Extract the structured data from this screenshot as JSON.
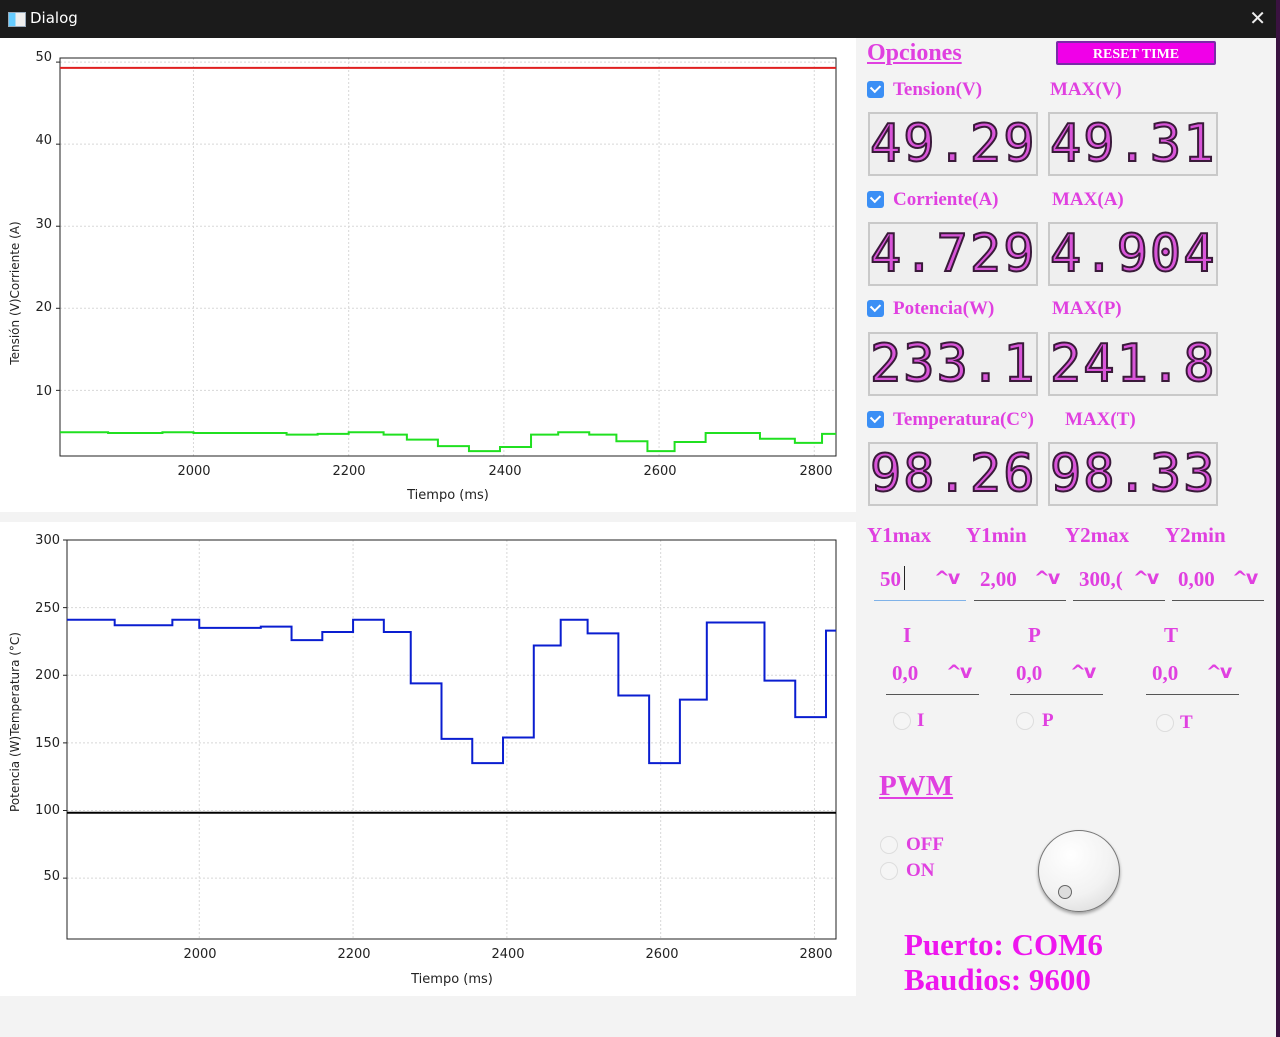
{
  "window": {
    "title": "Dialog"
  },
  "chart1": {
    "ylabel": "Tensión (V)Corriente (A)",
    "xlabel": "Tiempo (ms)",
    "yticks": [
      "50",
      "40",
      "30",
      "20",
      "10"
    ],
    "xticks": [
      "2000",
      "2200",
      "2400",
      "2600",
      "2800"
    ]
  },
  "chart2": {
    "ylabel": "Potencia (W)Temperatura (°C)",
    "xlabel": "Tiempo (ms)",
    "yticks": [
      "300",
      "250",
      "200",
      "150",
      "100",
      "50"
    ],
    "xticks": [
      "2000",
      "2200",
      "2400",
      "2600",
      "2800"
    ]
  },
  "chart_data": [
    {
      "type": "line",
      "xlabel": "Tiempo (ms)",
      "ylabel": "Tensión (V)Corriente (A)",
      "xlim": [
        1828,
        2828
      ],
      "ylim": [
        2,
        50.5
      ],
      "series": [
        {
          "color": "#e02020",
          "step": true,
          "x": [
            1828,
            2828
          ],
          "y": [
            49.3,
            49.3
          ]
        },
        {
          "color": "#20e020",
          "step": true,
          "x": [
            1828,
            1890,
            1960,
            2000,
            2080,
            2120,
            2160,
            2200,
            2245,
            2275,
            2315,
            2355,
            2395,
            2435,
            2470,
            2510,
            2545,
            2585,
            2620,
            2660,
            2730,
            2775,
            2810,
            2828
          ],
          "y": [
            4.9,
            4.8,
            4.9,
            4.8,
            4.8,
            4.6,
            4.7,
            4.9,
            4.6,
            4.0,
            3.2,
            2.6,
            3.1,
            4.6,
            4.9,
            4.6,
            3.8,
            2.6,
            3.7,
            4.8,
            4.1,
            3.6,
            4.7,
            4.7
          ]
        }
      ]
    },
    {
      "type": "line",
      "xlabel": "Tiempo (ms)",
      "ylabel": "Potencia (W)Temperatura (°C)",
      "xlim": [
        1828,
        2828
      ],
      "ylim": [
        5,
        300
      ],
      "series": [
        {
          "color": "#000000",
          "step": true,
          "x": [
            1828,
            2828
          ],
          "y": [
            98.3,
            98.3
          ]
        },
        {
          "color": "#0a1ed0",
          "step": true,
          "x": [
            1828,
            1890,
            1965,
            2000,
            2080,
            2120,
            2160,
            2200,
            2240,
            2275,
            2315,
            2355,
            2395,
            2435,
            2470,
            2505,
            2545,
            2585,
            2625,
            2660,
            2735,
            2775,
            2815,
            2828
          ],
          "y": [
            241,
            237,
            241,
            235,
            236,
            226,
            232,
            241,
            232,
            194,
            153,
            135,
            154,
            222,
            241,
            231,
            185,
            135,
            182,
            239,
            196,
            169,
            233,
            233
          ]
        }
      ]
    }
  ],
  "options": {
    "header": "Opciones",
    "reset_label": "RESET TIME",
    "tension_label": "Tension(V)",
    "max_v_label": "MAX(V)",
    "tension_value": "49.29",
    "max_v_value": "49.31",
    "corriente_label": "Corriente(A)",
    "max_a_label": "MAX(A)",
    "corriente_value": "4.729",
    "max_a_value": "4.904",
    "potencia_label": "Potencia(W)",
    "max_p_label": "MAX(P)",
    "potencia_value": "233.1",
    "max_p_value": "241.8",
    "temperatura_label": "Temperatura(C°)",
    "max_t_label": "MAX(T)",
    "temperatura_value": "98.26",
    "max_t_value": "98.33",
    "checkbox_tension": true,
    "checkbox_corriente": true,
    "checkbox_potencia": true,
    "checkbox_temperatura": true
  },
  "limits": {
    "y1max_label": "Y1max",
    "y1min_label": "Y1min",
    "y2max_label": "Y2max",
    "y2min_label": "Y2min",
    "y1max_value": "50",
    "y1min_value": "2,00",
    "y2max_value": "300,(",
    "y2min_value": "0,00"
  },
  "alarms": {
    "i_label": "I",
    "p_label": "P",
    "t_label": "T",
    "i_value": "0,0",
    "p_value": "0,0",
    "t_value": "0,0",
    "i_radio_label": "I",
    "p_radio_label": "P",
    "t_radio_label": "T"
  },
  "spin_arrows": "^v",
  "pwm": {
    "header": "PWM",
    "off_label": "OFF",
    "on_label": "ON"
  },
  "connection": {
    "port_text": "Puerto: COM6",
    "baud_text": "Baudios: 9600"
  }
}
